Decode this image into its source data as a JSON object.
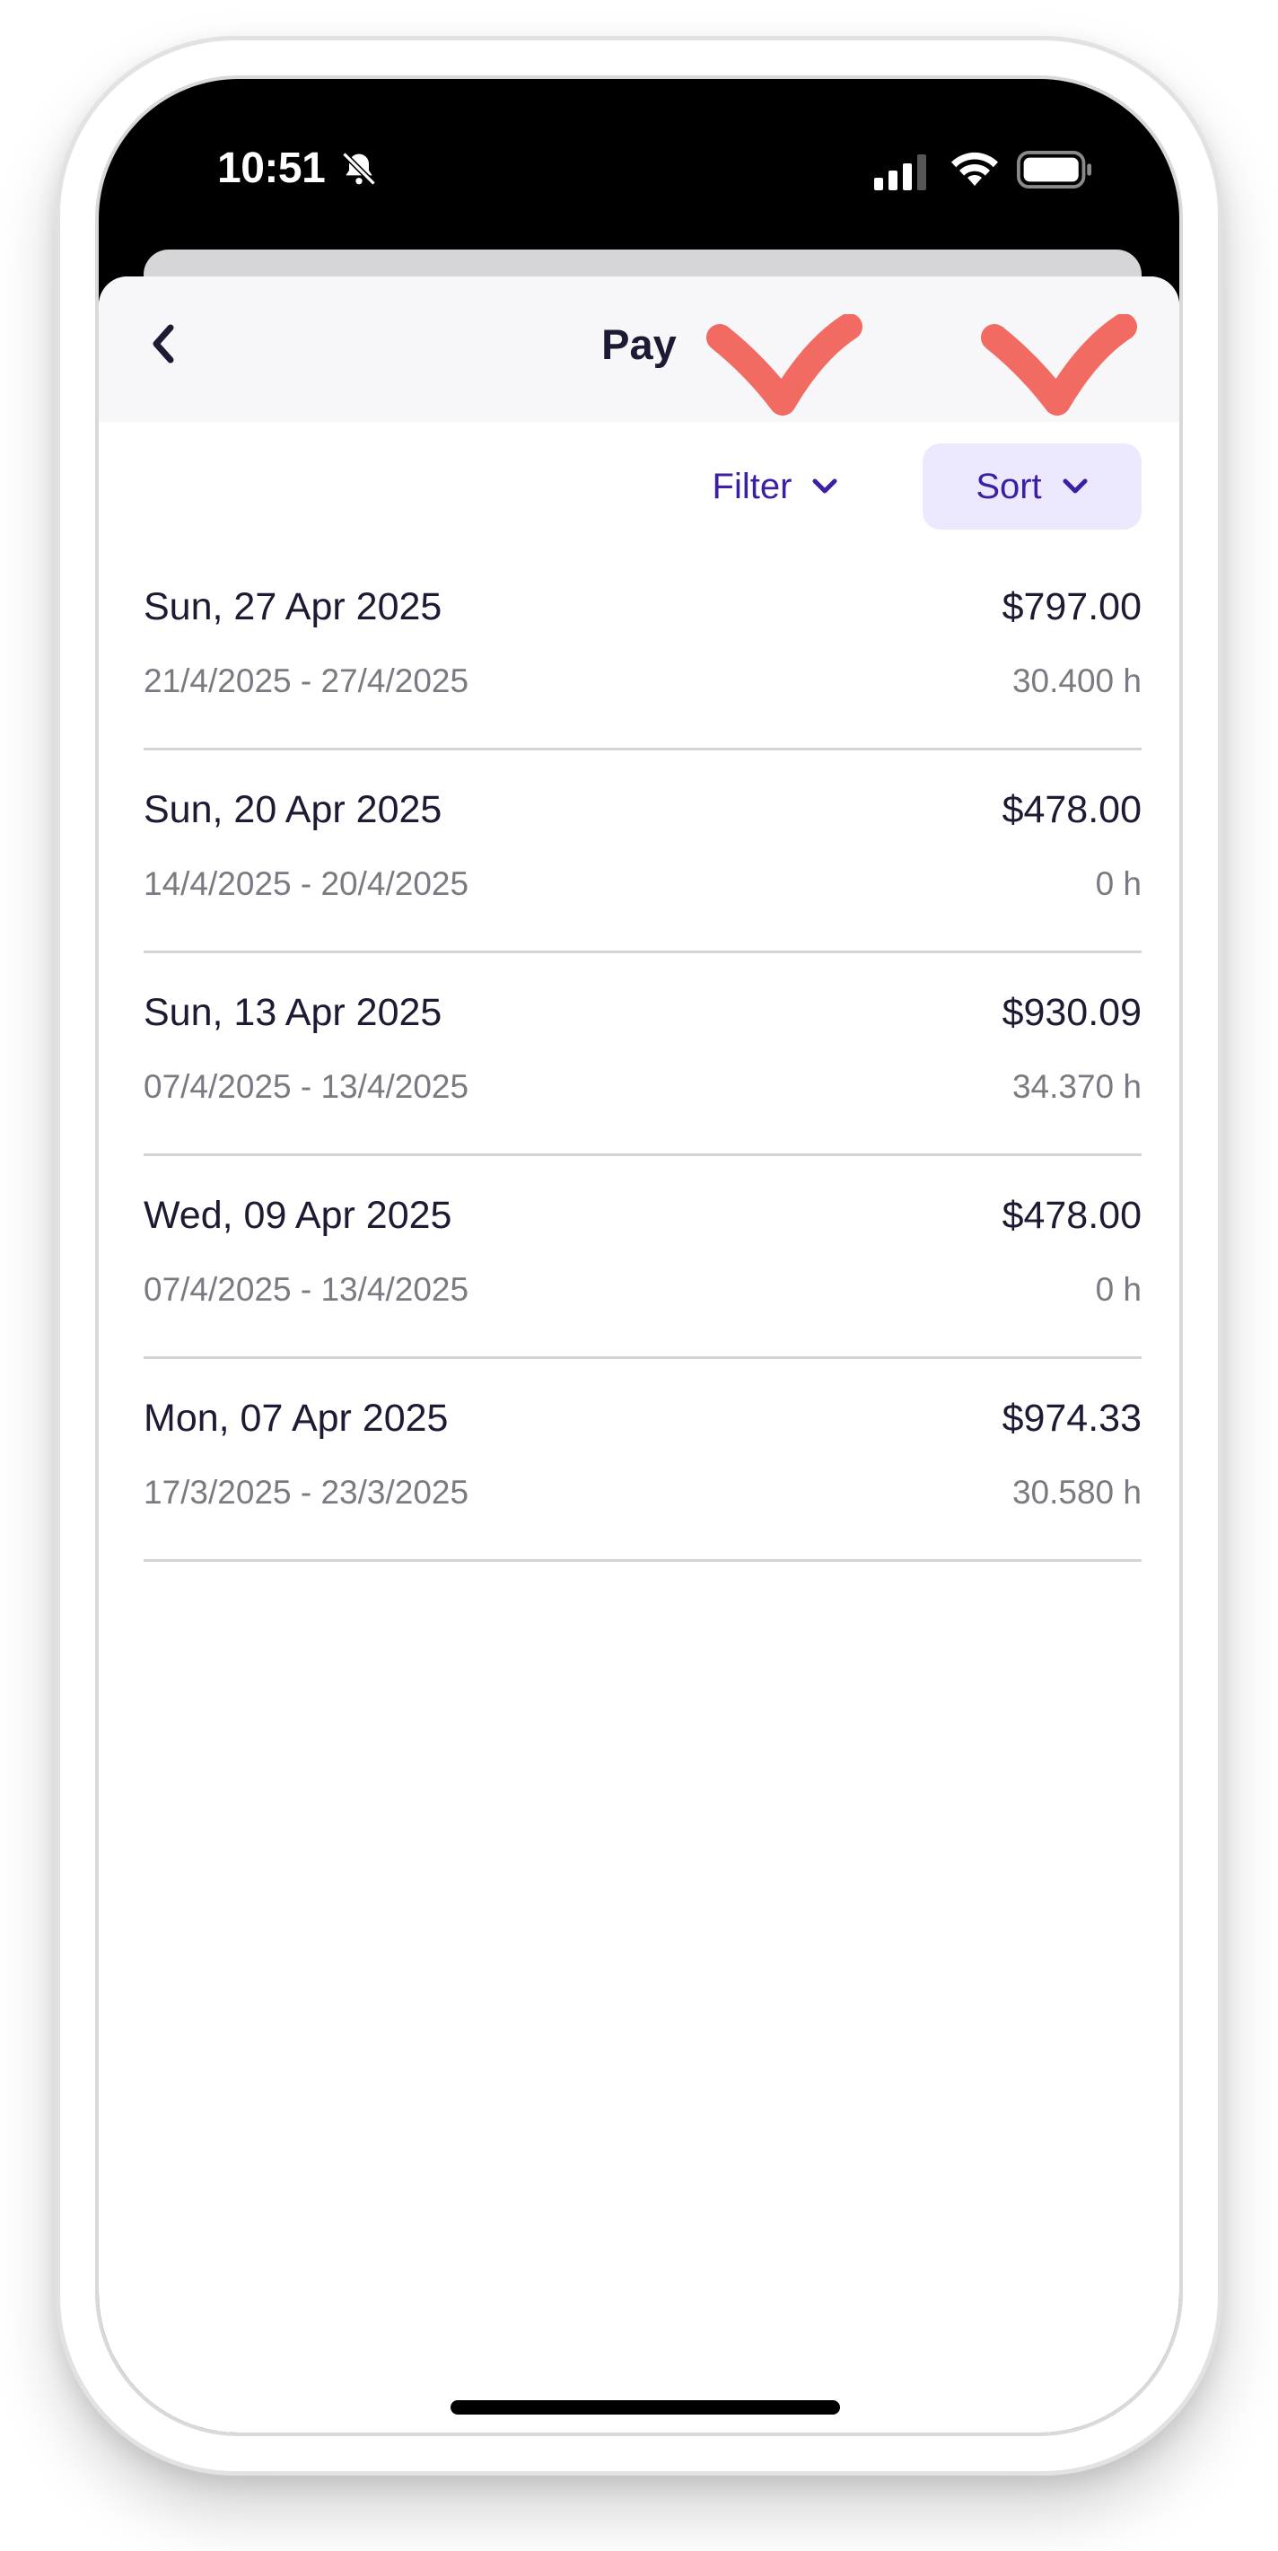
{
  "status_bar": {
    "time": "10:51",
    "icons": [
      "bell-slash-icon",
      "cellular-signal-icon",
      "wifi-icon",
      "battery-icon"
    ]
  },
  "nav": {
    "title": "Pay",
    "back_icon": "chevron-left-icon"
  },
  "controls": {
    "filter_label": "Filter",
    "sort_label": "Sort"
  },
  "pays": [
    {
      "date": "Sun, 27 Apr 2025",
      "range": "21/4/2025 - 27/4/2025",
      "amount": "$797.00",
      "hours": "30.400 h"
    },
    {
      "date": "Sun, 20 Apr 2025",
      "range": "14/4/2025 - 20/4/2025",
      "amount": "$478.00",
      "hours": "0 h"
    },
    {
      "date": "Sun, 13 Apr 2025",
      "range": "07/4/2025 - 13/4/2025",
      "amount": "$930.09",
      "hours": "34.370 h"
    },
    {
      "date": "Wed, 09 Apr 2025",
      "range": "07/4/2025 - 13/4/2025",
      "amount": "$478.00",
      "hours": "0 h"
    },
    {
      "date": "Mon, 07 Apr 2025",
      "range": "17/3/2025 - 23/3/2025",
      "amount": "$974.33",
      "hours": "30.580 h"
    }
  ],
  "colors": {
    "accent": "#3d1fa3",
    "sort_bg": "#ece8fd",
    "annotation": "#f26b63",
    "text_primary": "#1c1b33",
    "text_secondary": "#7a7a82"
  }
}
